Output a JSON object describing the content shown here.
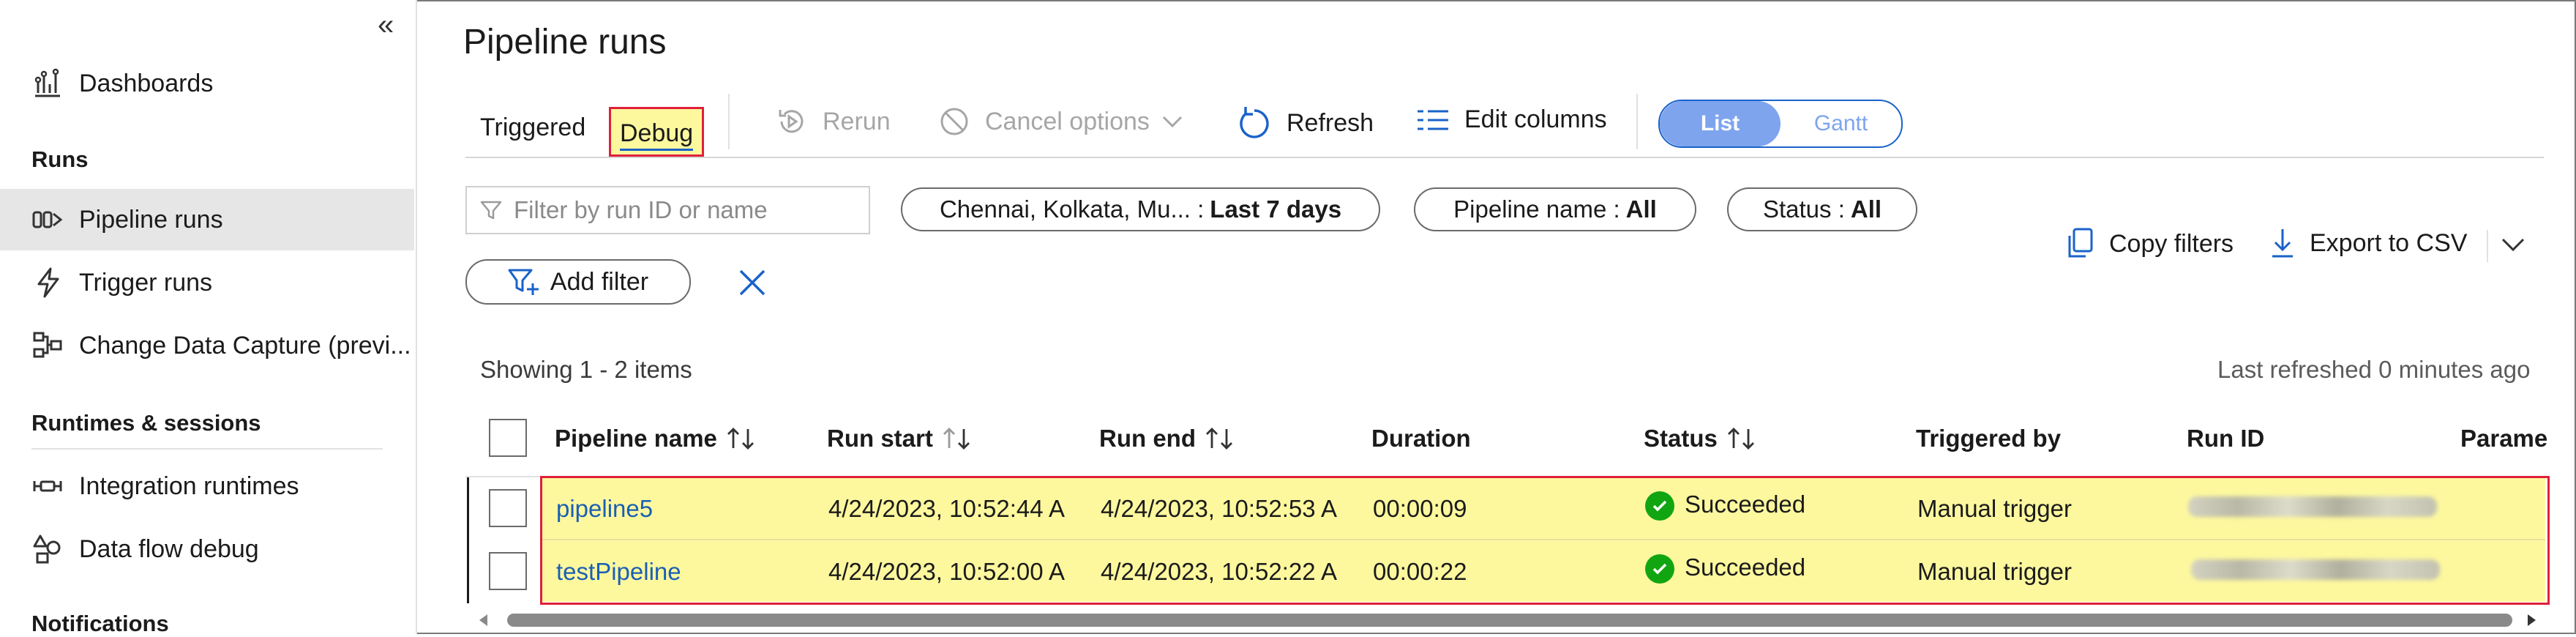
{
  "sidebar": {
    "collapse_glyph": "«",
    "items": [
      {
        "label": "Dashboards",
        "icon": "dashboard-icon"
      },
      {
        "label": "Pipeline runs",
        "icon": "pipeline-runs-icon"
      },
      {
        "label": "Trigger runs",
        "icon": "trigger-icon"
      },
      {
        "label": "Change Data Capture (previ...",
        "icon": "change-data-capture-icon"
      },
      {
        "label": "Integration runtimes",
        "icon": "integration-runtime-icon"
      },
      {
        "label": "Data flow debug",
        "icon": "data-flow-debug-icon"
      }
    ],
    "sections": {
      "runs": "Runs",
      "runtimes": "Runtimes & sessions",
      "notifications": "Notifications"
    }
  },
  "page": {
    "title": "Pipeline runs"
  },
  "tabs": {
    "triggered": "Triggered",
    "debug": "Debug"
  },
  "toolbar": {
    "rerun": "Rerun",
    "cancel": "Cancel options",
    "refresh": "Refresh",
    "edit_columns": "Edit columns",
    "view_list": "List",
    "view_gantt": "Gantt"
  },
  "filters": {
    "search_placeholder": "Filter by run ID or name",
    "time_prefix": "Chennai, Kolkata, Mu... :",
    "time_value": "Last 7 days",
    "pipeline_prefix": "Pipeline name :",
    "pipeline_value": "All",
    "status_prefix": "Status :",
    "status_value": "All",
    "add_filter": "Add filter",
    "copy_filters": "Copy filters",
    "export_csv": "Export to CSV"
  },
  "list": {
    "showing": "Showing 1 - 2 items",
    "last_refreshed": "Last refreshed 0 minutes ago"
  },
  "table": {
    "columns": [
      "Pipeline name",
      "Run start",
      "Run end",
      "Duration",
      "Status",
      "Triggered by",
      "Run ID",
      "Parame"
    ],
    "rows": [
      {
        "pipeline": "pipeline5",
        "start": "4/24/2023, 10:52:44 A",
        "end": "4/24/2023, 10:52:53 A",
        "duration": "00:00:09",
        "status": "Succeeded",
        "trigger": "Manual trigger"
      },
      {
        "pipeline": "testPipeline",
        "start": "4/24/2023, 10:52:00 A",
        "end": "4/24/2023, 10:52:22 A",
        "duration": "00:00:22",
        "status": "Succeeded",
        "trigger": "Manual trigger"
      }
    ]
  },
  "colors": {
    "accent": "#1a62c9",
    "link": "#1a5fb4",
    "highlight": "#fdf89e",
    "highlight_border": "#e0203a",
    "success": "#12a512"
  }
}
